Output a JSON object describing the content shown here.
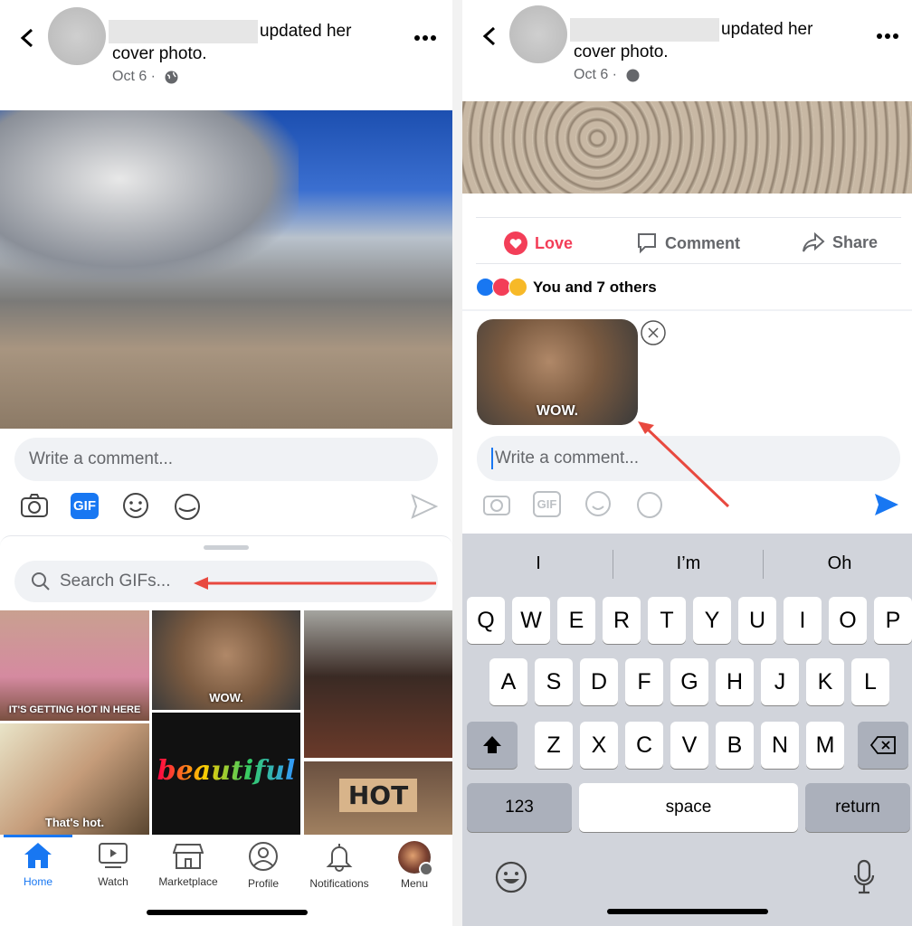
{
  "post": {
    "action_text": "updated her",
    "action_text_2": "cover photo.",
    "date": "Oct 6 ·"
  },
  "left": {
    "comment_placeholder": "Write a comment...",
    "search_placeholder": "Search GIFs...",
    "gifs": [
      {
        "caption": "IT'S GETTING HOT IN HERE"
      },
      {
        "caption": "That's hot."
      },
      {
        "caption": "WOW."
      },
      {
        "caption": "beautiful"
      },
      {
        "caption": ""
      },
      {
        "caption": "HOT"
      }
    ],
    "tabs": [
      {
        "label": "Home",
        "active": true
      },
      {
        "label": "Watch"
      },
      {
        "label": "Marketplace"
      },
      {
        "label": "Profile"
      },
      {
        "label": "Notifications"
      },
      {
        "label": "Menu"
      }
    ]
  },
  "right": {
    "actions": {
      "love": "Love",
      "comment": "Comment",
      "share": "Share"
    },
    "reactions_text": "You and 7 others",
    "gif_caption": "WOW.",
    "comment_placeholder": "Write a comment...",
    "suggestions": [
      "I",
      "I’m",
      "Oh"
    ],
    "keys_row1": [
      "Q",
      "W",
      "E",
      "R",
      "T",
      "Y",
      "U",
      "I",
      "O",
      "P"
    ],
    "keys_row2": [
      "A",
      "S",
      "D",
      "F",
      "G",
      "H",
      "J",
      "K",
      "L"
    ],
    "keys_row3": [
      "Z",
      "X",
      "C",
      "V",
      "B",
      "N",
      "M"
    ],
    "key_123": "123",
    "key_space": "space",
    "key_return": "return"
  },
  "colors": {
    "accent": "#1877f2",
    "love": "#f33e58",
    "arrow": "#e8493f"
  }
}
